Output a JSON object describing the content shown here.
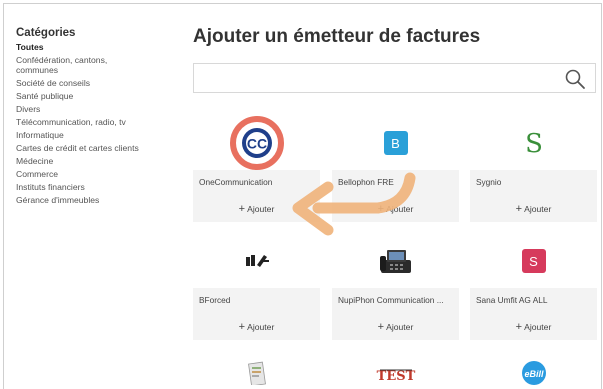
{
  "sidebar": {
    "title": "Catégories",
    "items": [
      {
        "label": "Toutes"
      },
      {
        "label": "Confédération, cantons,"
      },
      {
        "label": "communes"
      },
      {
        "label": "Société de conseils"
      },
      {
        "label": "Santé publique"
      },
      {
        "label": "Divers"
      },
      {
        "label": "Télécommunication, radio, tv"
      },
      {
        "label": "Informatique"
      },
      {
        "label": "Cartes de crédit et cartes clients"
      },
      {
        "label": "Médecine"
      },
      {
        "label": "Commerce"
      },
      {
        "label": "Instituts financiers"
      },
      {
        "label": "Gérance d'immeubles"
      }
    ]
  },
  "main": {
    "title": "Ajouter un émetteur de factures",
    "search": {
      "value": "",
      "placeholder": ""
    },
    "cards": [
      {
        "name": "OneCommunication",
        "add_label": "Ajouter",
        "logo": "cc-logo-icon",
        "logo_text": "CC"
      },
      {
        "name": "Bellophon FRE",
        "add_label": "Ajouter",
        "logo": "b-badge-icon",
        "logo_text": "B"
      },
      {
        "name": "Sygnio",
        "add_label": "Ajouter",
        "logo": "s-script-icon",
        "logo_text": "S"
      },
      {
        "name": "BForced",
        "add_label": "Ajouter",
        "logo": "bforced-logo-icon"
      },
      {
        "name": "NupiPhon Communication ...",
        "add_label": "Ajouter",
        "logo": "desk-phone-icon"
      },
      {
        "name": "Sana Umfit AG ALL",
        "add_label": "Ajouter",
        "logo": "s-badge-icon",
        "logo_text": "S"
      },
      {
        "name": "",
        "add_label": "",
        "logo": "document-icon"
      },
      {
        "name": "",
        "add_label": "",
        "logo": "test-logo-icon",
        "logo_text": "TEST"
      },
      {
        "name": "",
        "add_label": "",
        "logo": "ebill-logo-icon",
        "logo_text": "eBill"
      }
    ]
  },
  "colors": {
    "highlight_ring": "#e8705f",
    "arrow": "#f0b27a",
    "b_badge": "#2aa0d8",
    "s_badge": "#d63a5c",
    "ebill": "#2a9be0"
  }
}
